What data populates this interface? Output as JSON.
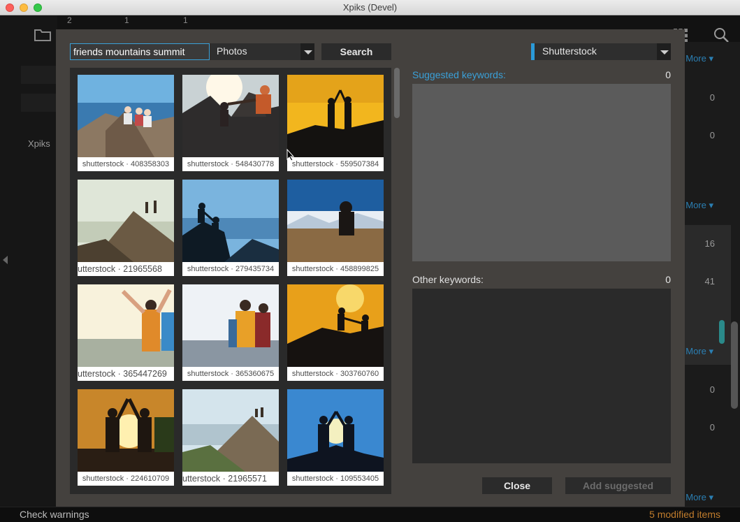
{
  "window": {
    "title": "Xpiks (Devel)"
  },
  "background": {
    "toolbar_counts": [
      "2",
      "1",
      "1"
    ],
    "left_label": "Xpiks",
    "right_numbers": [
      "0",
      "0",
      "16",
      "41",
      "0",
      "0"
    ],
    "more_label": "More ▾"
  },
  "dialog": {
    "search": {
      "value": "friends mountains summit",
      "placeholder": ""
    },
    "type_select": {
      "selected": "Photos"
    },
    "search_button": "Search",
    "source_select": {
      "selected": "Shutterstock"
    },
    "results": [
      {
        "caption": "shutterstock · 408358303",
        "icon": "photo-friends-summit-lake"
      },
      {
        "caption": "shutterstock · 548430778",
        "icon": "photo-climber-helping-hand"
      },
      {
        "caption": "shutterstock · 559507384",
        "icon": "photo-high-five-silhouette"
      },
      {
        "caption": "utterstock · 21965568",
        "icon": "photo-peak-two-climbers"
      },
      {
        "caption": "shutterstock · 279435734",
        "icon": "photo-climbers-silhouette-blue"
      },
      {
        "caption": "shutterstock · 458899825",
        "icon": "photo-dog-mountain"
      },
      {
        "caption": "utterstock · 365447269",
        "icon": "photo-hikers-arms-up"
      },
      {
        "caption": "shutterstock · 365360675",
        "icon": "photo-hikers-backpacks"
      },
      {
        "caption": "shutterstock · 303760760",
        "icon": "photo-sunset-help-hand"
      },
      {
        "caption": "shutterstock · 224610709",
        "icon": "photo-sun-high-five"
      },
      {
        "caption": "utterstock · 21965571",
        "icon": "photo-peak-climbers-wide"
      },
      {
        "caption": "shutterstock · 109553405",
        "icon": "photo-hands-heart-sun"
      }
    ],
    "suggested_keywords": {
      "label": "Suggested keywords:",
      "count": "0"
    },
    "other_keywords": {
      "label": "Other keywords:",
      "count": "0"
    },
    "close_button": "Close",
    "add_suggested_button": "Add suggested"
  },
  "status": {
    "left": "Check warnings",
    "right": "5 modified items"
  },
  "colors": {
    "accent": "#2a9ad8",
    "modified": "#c07c2c",
    "suggested_label": "#3aa0d8"
  }
}
